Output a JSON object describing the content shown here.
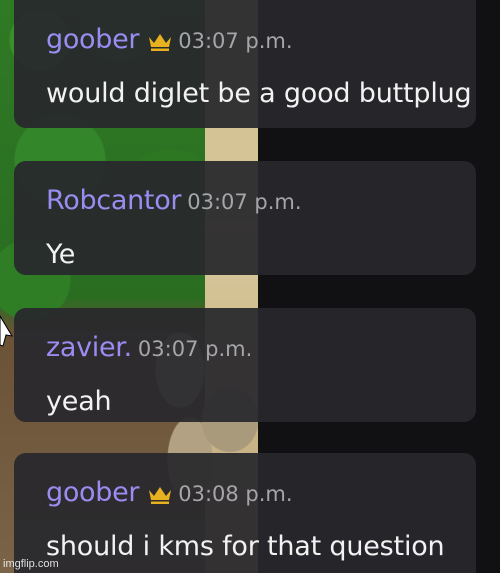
{
  "messages": [
    {
      "username": "goober",
      "has_crown": true,
      "timestamp": "03:07 p.m.",
      "text": "would diglet be a good buttplug"
    },
    {
      "username": "Robcantor",
      "has_crown": false,
      "timestamp": "03:07 p.m.",
      "text": "Ye"
    },
    {
      "username": "zavier.",
      "has_crown": false,
      "timestamp": "03:07 p.m.",
      "text": "yeah"
    },
    {
      "username": "goober",
      "has_crown": true,
      "timestamp": "03:08 p.m.",
      "text": "should i kms for that question"
    }
  ],
  "watermark": "imgflip.com",
  "colors": {
    "username": "#9b8cf2",
    "crown": "#e8b21f",
    "timestamp": "#a5a5aa",
    "message_text": "#f2f2f2",
    "bubble": "#28282c"
  },
  "icons": {
    "crown": "crown-icon",
    "cursor": "mouse-cursor-icon"
  }
}
